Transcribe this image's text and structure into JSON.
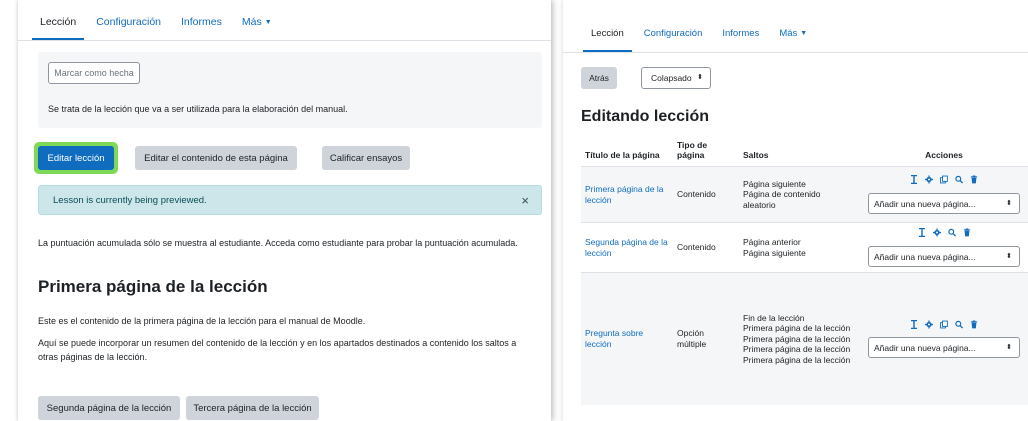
{
  "left": {
    "tabs": [
      "Lección",
      "Configuración",
      "Informes",
      "Más"
    ],
    "mark_done_label": "Marcar como hecha",
    "description": "Se trata de la lección que va a ser utilizada para la elaboración del manual.",
    "buttons": {
      "edit": "Editar lección",
      "edit_content": "Editar el contenido de esta página",
      "grade": "Calificar ensayos"
    },
    "alert": {
      "text": "Lesson is currently being previewed.",
      "close": "×"
    },
    "score_note": "La puntuación acumulada sólo se muestra al estudiante. Acceda como estudiante para probar la puntuación acumulada.",
    "page_title": "Primera página de la lección",
    "content_1": "Este es el contenido de la primera página de la lección para el manual de Moodle.",
    "content_2": "Aquí se puede incorporar un resumen del contenido de la lección y en los apartados destinados a contenido los saltos a otras páginas de la lección.",
    "nav_buttons": [
      "Segunda página de la lección",
      "Tercera página de la lección"
    ]
  },
  "right": {
    "tabs": [
      "Lección",
      "Configuración",
      "Informes",
      "Más"
    ],
    "back_label": "Atrás",
    "collapse_value": "Colapsado",
    "heading": "Editando lección",
    "columns": [
      "Título de la página",
      "Tipo de página",
      "Saltos",
      "Acciones"
    ],
    "add_placeholder": "Añadir una nueva página...",
    "rows": [
      {
        "title": "Primera página de la lección",
        "type": "Contenido",
        "jumps": [
          "Página siguiente",
          "Página de contenido aleatorio"
        ],
        "icons": 5
      },
      {
        "title": "Segunda página de la lección",
        "type": "Contenido",
        "jumps": [
          "Página anterior",
          "Página siguiente"
        ],
        "icons": 4
      },
      {
        "title": "Pregunta sobre lección",
        "type": "Opción múltiple",
        "jumps": [
          "Fin de la lección",
          "Primera página de la lección",
          "Primera página de la lección",
          "Primera página de la lección",
          "Primera página de la lección"
        ],
        "icons": 5
      }
    ]
  },
  "colors": {
    "brand": "#0f6cbf",
    "highlight": "#7ed957",
    "alert_bg": "#cce6ea"
  }
}
